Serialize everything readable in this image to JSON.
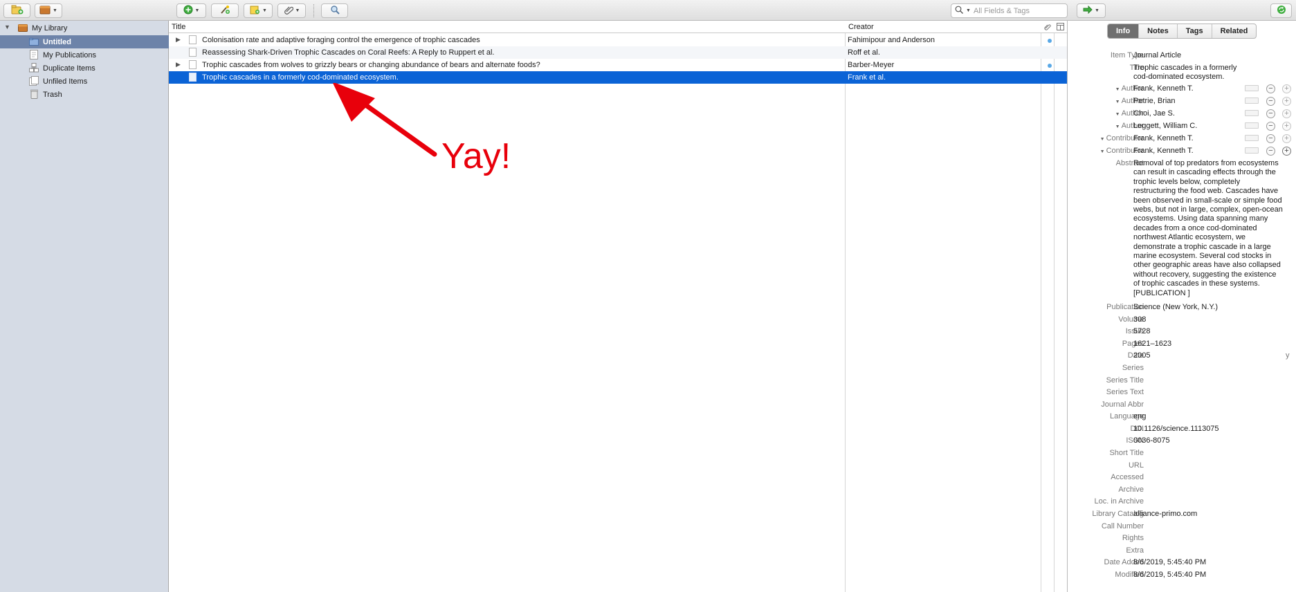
{
  "toolbar": {
    "search_placeholder": "All Fields & Tags"
  },
  "collections": [
    {
      "label": "My Library",
      "icon": "library-icon"
    },
    {
      "label": "Untitled",
      "icon": "folder-icon",
      "selected": true
    },
    {
      "label": "My Publications",
      "icon": "publications-icon"
    },
    {
      "label": "Duplicate Items",
      "icon": "duplicate-icon"
    },
    {
      "label": "Unfiled Items",
      "icon": "unfiled-icon"
    },
    {
      "label": "Trash",
      "icon": "trash-icon"
    }
  ],
  "items_header": {
    "title": "Title",
    "creator": "Creator"
  },
  "items": [
    {
      "title": "Colonisation rate and adaptive foraging control the emergence of trophic cascades",
      "creator": "Fahimipour and Anderson",
      "has_children": true,
      "has_dot": true
    },
    {
      "title": "Reassessing Shark-Driven Trophic Cascades on Coral Reefs: A Reply to Ruppert et al.",
      "creator": "Roff et al.",
      "has_children": false,
      "has_dot": false
    },
    {
      "title": "Trophic cascades from wolves to grizzly bears or changing abundance of bears and alternate foods?",
      "creator": "Barber-Meyer",
      "has_children": true,
      "has_dot": true
    },
    {
      "title": "Trophic cascades in a formerly cod-dominated ecosystem.",
      "creator": "Frank et al.",
      "has_children": false,
      "has_dot": false,
      "selected": true
    }
  ],
  "annotation": {
    "text": "Yay!",
    "color": "#e8000b"
  },
  "tabs": [
    "Info",
    "Notes",
    "Tags",
    "Related"
  ],
  "info": {
    "item_type_label": "Item Type",
    "item_type": "Journal Article",
    "title_label": "Title",
    "title": "Trophic cascades in a formerly\ncod-dominated ecosystem.",
    "creators": [
      {
        "role": "Author",
        "name": "Frank, Kenneth T."
      },
      {
        "role": "Author",
        "name": "Petrie, Brian"
      },
      {
        "role": "Author",
        "name": "Choi, Jae S."
      },
      {
        "role": "Author",
        "name": "Leggett, William C."
      },
      {
        "role": "Contributor",
        "name": "Frank, Kenneth T."
      },
      {
        "role": "Contributor",
        "name": "Frank, Kenneth T."
      }
    ],
    "abstract_label": "Abstract",
    "abstract": "Removal of top predators from ecosystems\ncan result in cascading effects through the\ntrophic levels below, completely\nrestructuring the food web. Cascades have\nbeen observed in small-scale or simple food\nwebs, but not in large, complex, open-ocean\necosystems. Using data spanning many\ndecades from a once cod-dominated\nnorthwest Atlantic ecosystem, we\ndemonstrate a trophic cascade in a large\nmarine ecosystem. Several cod stocks in\nother geographic areas have also collapsed\nwithout recovery, suggesting the existence\nof trophic cascades in these systems.\n[PUBLICATION ]",
    "fields": [
      {
        "label": "Publication",
        "value": "Science (New York, N.Y.)"
      },
      {
        "label": "Volume",
        "value": "308"
      },
      {
        "label": "Issue",
        "value": "5728"
      },
      {
        "label": "Pages",
        "value": "1621–1623"
      },
      {
        "label": "Date",
        "value": "2005",
        "extra": "y"
      },
      {
        "label": "Series",
        "value": ""
      },
      {
        "label": "Series Title",
        "value": ""
      },
      {
        "label": "Series Text",
        "value": ""
      },
      {
        "label": "Journal Abbr",
        "value": ""
      },
      {
        "label": "Language",
        "value": "eng"
      },
      {
        "label": "DOI",
        "value": "10.1126/science.1113075"
      },
      {
        "label": "ISSN",
        "value": "0036-8075"
      },
      {
        "label": "Short Title",
        "value": ""
      },
      {
        "label": "URL",
        "value": ""
      },
      {
        "label": "Accessed",
        "value": ""
      },
      {
        "label": "Archive",
        "value": ""
      },
      {
        "label": "Loc. in Archive",
        "value": ""
      },
      {
        "label": "Library Catalog",
        "value": "alliance-primo.com"
      },
      {
        "label": "Call Number",
        "value": ""
      },
      {
        "label": "Rights",
        "value": ""
      },
      {
        "label": "Extra",
        "value": ""
      },
      {
        "label": "Date Added",
        "value": "8/6/2019, 5:45:40 PM"
      },
      {
        "label": "Modified",
        "value": "8/6/2019, 5:45:40 PM"
      }
    ]
  }
}
